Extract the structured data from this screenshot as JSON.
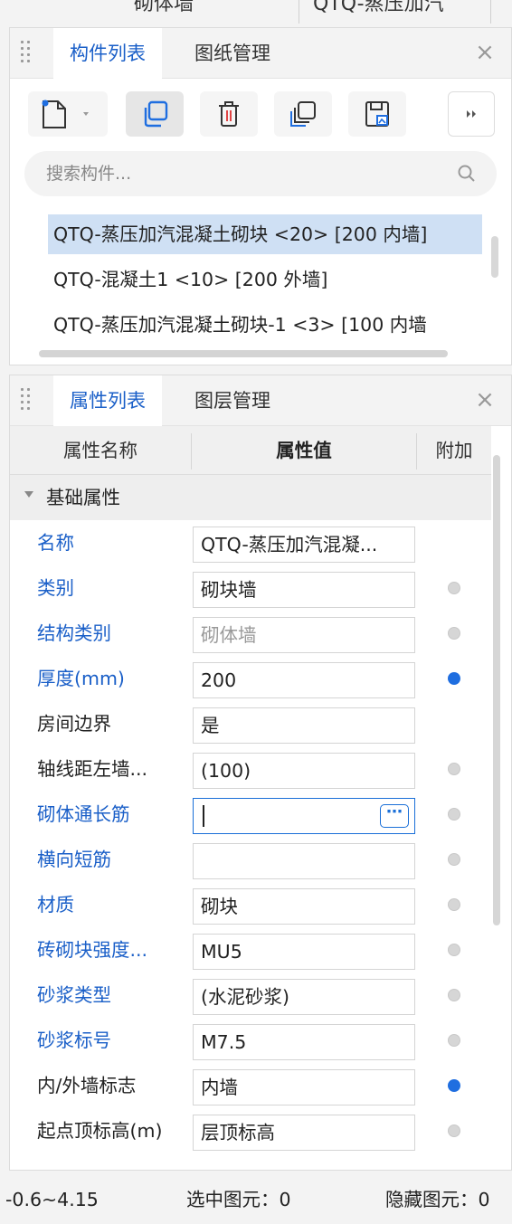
{
  "top_strip": {
    "cell1": "砌体墙",
    "cell2": "QTQ-蒸压加汽"
  },
  "component_panel": {
    "tabs": [
      {
        "label": "构件列表",
        "active": true
      },
      {
        "label": "图纸管理",
        "active": false
      }
    ],
    "close_symbol": "×",
    "toolbar": [
      "new-component-icon",
      "dropdown-arrow-icon",
      "copy-icon",
      "delete-icon",
      "layer-copy-icon",
      "save-image-icon",
      "more-icon"
    ],
    "search": {
      "placeholder": "搜索构件..."
    },
    "items": [
      {
        "text": "QTQ-蒸压加汽混凝土砌块 <20> [200 内墙]",
        "selected": true
      },
      {
        "text": "QTQ-混凝土1 <10> [200 外墙]",
        "selected": false
      },
      {
        "text": "QTQ-蒸压加汽混凝土砌块-1 <3> [100 内墙",
        "selected": false
      }
    ]
  },
  "property_panel": {
    "tabs": [
      {
        "label": "属性列表",
        "active": true
      },
      {
        "label": "图层管理",
        "active": false
      }
    ],
    "close_symbol": "×",
    "headers": {
      "name": "属性名称",
      "value": "属性值",
      "extra": "附加"
    },
    "group": "基础属性",
    "rows": [
      {
        "name": "名称",
        "value": "QTQ-蒸压加汽混凝...",
        "name_color": "blue",
        "value_style": "normal",
        "dot": null
      },
      {
        "name": "类别",
        "value": "砌块墙",
        "name_color": "blue",
        "value_style": "normal",
        "dot": "off"
      },
      {
        "name": "结构类别",
        "value": "砌体墙",
        "name_color": "blue",
        "value_style": "grey",
        "dot": "off"
      },
      {
        "name": "厚度(mm)",
        "value": "200",
        "name_color": "blue",
        "value_style": "normal",
        "dot": "on"
      },
      {
        "name": "房间边界",
        "value": "是",
        "name_color": "black",
        "value_style": "normal",
        "dot": null
      },
      {
        "name": "轴线距左墙...",
        "value": "(100)",
        "name_color": "black",
        "value_style": "normal",
        "dot": "off"
      },
      {
        "name": "砌体通长筋",
        "value": "",
        "name_color": "blue",
        "value_style": "editing",
        "dot": "off",
        "button": "⋯"
      },
      {
        "name": "横向短筋",
        "value": "",
        "name_color": "blue",
        "value_style": "normal",
        "dot": "off"
      },
      {
        "name": "材质",
        "value": "砌块",
        "name_color": "blue",
        "value_style": "normal",
        "dot": "off"
      },
      {
        "name": "砖砌块强度...",
        "value": "MU5",
        "name_color": "blue",
        "value_style": "normal",
        "dot": "off"
      },
      {
        "name": "砂浆类型",
        "value": "(水泥砂浆)",
        "name_color": "blue",
        "value_style": "normal",
        "dot": "off"
      },
      {
        "name": "砂浆标号",
        "value": "M7.5",
        "name_color": "blue",
        "value_style": "normal",
        "dot": "off"
      },
      {
        "name": "内/外墙标志",
        "value": "内墙",
        "name_color": "black",
        "value_style": "normal",
        "dot": "on"
      },
      {
        "name": "起点顶标高(m)",
        "value": "层顶标高",
        "name_color": "black",
        "value_style": "normal",
        "dot": "off"
      }
    ]
  },
  "status_bar": {
    "elevation": "-0.6~4.15",
    "selected": "选中图元：0",
    "hidden": "隐藏图元：0"
  },
  "colors": {
    "accent": "#1a5fc8",
    "selection": "#cfe0f4",
    "dot_on": "#1f6ee0"
  }
}
